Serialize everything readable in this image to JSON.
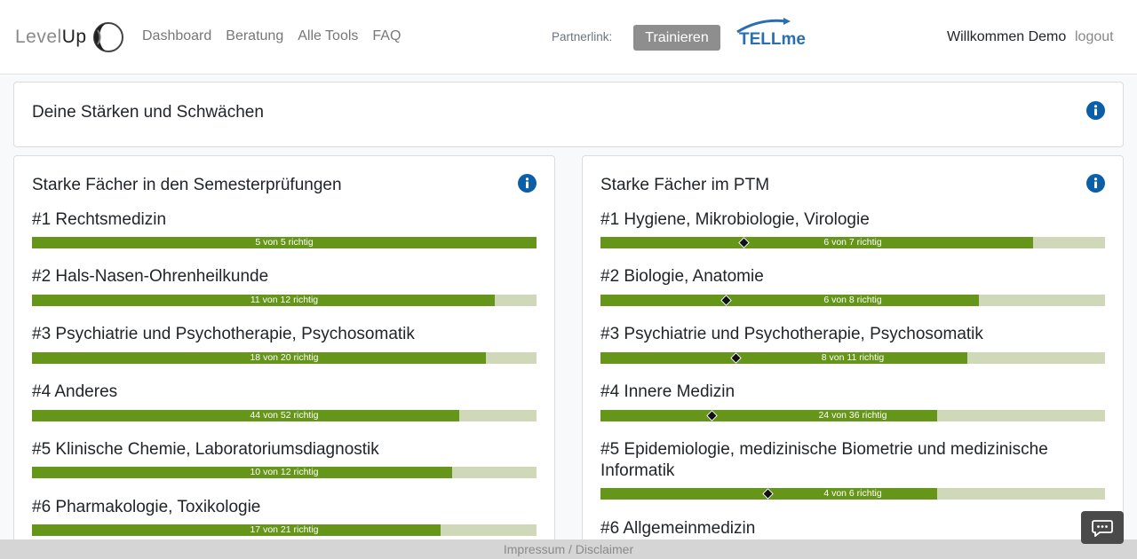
{
  "nav": {
    "brand_light": "Level",
    "brand_dark": "Up",
    "links": [
      "Dashboard",
      "Beratung",
      "Alle Tools",
      "FAQ"
    ],
    "partner_label": "Partnerlink:",
    "train_button": "Trainieren",
    "partner_logo_text": "TELLme",
    "welcome": "Willkommen Demo",
    "logout": "logout"
  },
  "header_card": {
    "title": "Deine Stärken und Schwächen"
  },
  "left_card": {
    "title": "Starke Fächer in den Semesterprüfungen",
    "items": [
      {
        "title": "#1 Rechtsmedizin",
        "label": "5 von 5 richtig",
        "correct": 5,
        "total": 5
      },
      {
        "title": "#2 Hals-Nasen-Ohrenheilkunde",
        "label": "11 von 12 richtig",
        "correct": 11,
        "total": 12
      },
      {
        "title": "#3 Psychiatrie und Psychotherapie, Psychosomatik",
        "label": "18 von 20 richtig",
        "correct": 18,
        "total": 20
      },
      {
        "title": "#4 Anderes",
        "label": "44 von 52 richtig",
        "correct": 44,
        "total": 52
      },
      {
        "title": "#5 Klinische Chemie, Laboratoriumsdiagnostik",
        "label": "10 von 12 richtig",
        "correct": 10,
        "total": 12
      },
      {
        "title": "#6 Pharmakologie, Toxikologie",
        "label": "17 von 21 richtig",
        "correct": 17,
        "total": 21
      }
    ]
  },
  "right_card": {
    "title": "Starke Fächer im PTM",
    "items": [
      {
        "title": "#1 Hygiene, Mikrobiologie, Virologie",
        "label": "6 von 7 richtig",
        "correct": 6,
        "total": 7,
        "marker": 0.285
      },
      {
        "title": "#2 Biologie, Anatomie",
        "label": "6 von 8 richtig",
        "correct": 6,
        "total": 8,
        "marker": 0.25
      },
      {
        "title": "#3 Psychiatrie und Psychotherapie, Psychosomatik",
        "label": "8 von 11 richtig",
        "correct": 8,
        "total": 11,
        "marker": 0.27
      },
      {
        "title": "#4 Innere Medizin",
        "label": "24 von 36 richtig",
        "correct": 24,
        "total": 36,
        "marker": 0.222
      },
      {
        "title": "#5 Epidemiologie, medizinische Biometrie und medizinische Informatik",
        "label": "4 von 6 richtig",
        "correct": 4,
        "total": 6,
        "marker": 0.333
      },
      {
        "title": "#6 Allgemeinmedizin",
        "label": "",
        "correct": 0,
        "total": 0,
        "marker": null
      }
    ]
  },
  "footer": {
    "text": "Impressum / Disclaimer"
  },
  "colors": {
    "bar_fill": "#65961a",
    "bar_track": "#cfd8b9",
    "info": "#0b5ea8",
    "train_button": "#8e8e8e"
  }
}
